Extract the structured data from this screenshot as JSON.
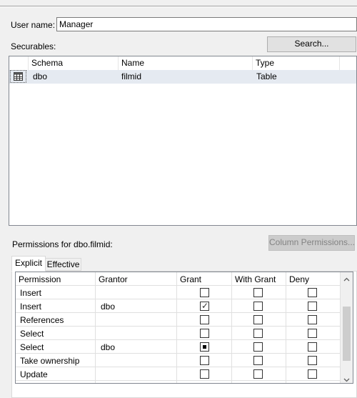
{
  "user": {
    "label": "User name:",
    "value": "Manager"
  },
  "securables": {
    "label": "Securables:",
    "search_button": "Search...",
    "columns": [
      "Schema",
      "Name",
      "Type"
    ],
    "rows": [
      {
        "icon": "table-icon",
        "schema": "dbo",
        "name": "filmid",
        "type": "Table"
      }
    ]
  },
  "permissions": {
    "label": "Permissions for dbo.filmid:",
    "column_permissions_button": "Column Permissions...",
    "tabs": [
      "Explicit",
      "Effective"
    ],
    "columns": [
      "Permission",
      "Grantor",
      "Grant",
      "With Grant",
      "Deny"
    ],
    "rows": [
      {
        "permission": "Insert",
        "grantor": "",
        "grant": "unchecked",
        "with_grant": "unchecked",
        "deny": "unchecked"
      },
      {
        "permission": "Insert",
        "grantor": "dbo",
        "grant": "checked",
        "with_grant": "unchecked",
        "deny": "unchecked"
      },
      {
        "permission": "References",
        "grantor": "",
        "grant": "unchecked",
        "with_grant": "unchecked",
        "deny": "unchecked"
      },
      {
        "permission": "Select",
        "grantor": "",
        "grant": "unchecked",
        "with_grant": "unchecked",
        "deny": "unchecked"
      },
      {
        "permission": "Select",
        "grantor": "dbo",
        "grant": "indeterminate",
        "with_grant": "unchecked",
        "deny": "unchecked"
      },
      {
        "permission": "Take ownership",
        "grantor": "",
        "grant": "unchecked",
        "with_grant": "unchecked",
        "deny": "unchecked"
      },
      {
        "permission": "Update",
        "grantor": "",
        "grant": "unchecked",
        "with_grant": "unchecked",
        "deny": "unchecked"
      }
    ]
  },
  "icons": {
    "scroll_up": "chevron-up-icon",
    "scroll_down": "chevron-down-icon"
  }
}
